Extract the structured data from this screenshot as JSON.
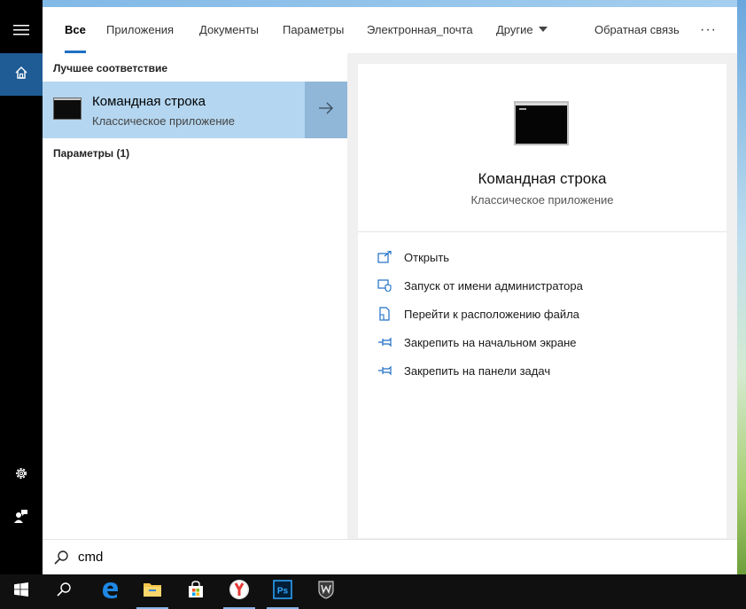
{
  "tabs": {
    "all": "Все",
    "apps": "Приложения",
    "docs": "Документы",
    "settings": "Параметры",
    "email": "Электронная_почта",
    "other": "Другие",
    "feedback": "Обратная связь",
    "more": "···"
  },
  "results": {
    "best_match_heading": "Лучшее соответствие",
    "best_match": {
      "title": "Командная строка",
      "subtitle": "Классическое приложение"
    },
    "settings_heading": "Параметры (1)"
  },
  "detail": {
    "title": "Командная строка",
    "subtitle": "Классическое приложение",
    "actions": [
      {
        "label": "Открыть",
        "icon": "open-icon"
      },
      {
        "label": "Запуск от имени администратора",
        "icon": "shield-icon"
      },
      {
        "label": "Перейти к расположению файла",
        "icon": "file-location-icon"
      },
      {
        "label": "Закрепить на начальном экране",
        "icon": "pin-icon"
      },
      {
        "label": "Закрепить на панели задач",
        "icon": "pin-icon"
      }
    ]
  },
  "search": {
    "query": "cmd"
  },
  "taskbar": {
    "apps": [
      "start",
      "search",
      "edge",
      "explorer",
      "store",
      "yandex",
      "photoshop",
      "world-of-tanks"
    ],
    "ps_label": "Ps"
  },
  "colors": {
    "accent": "#1f6fc5",
    "selected": "#b4d6f0",
    "sidebar": "#000000",
    "home_active": "#1f5b94"
  }
}
